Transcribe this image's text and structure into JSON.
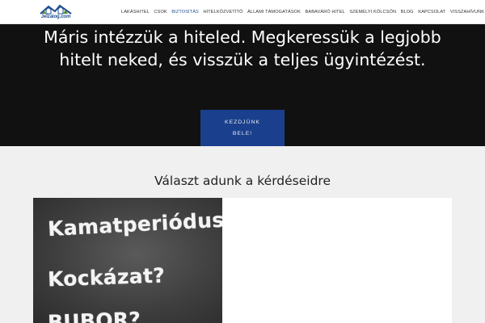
{
  "header": {
    "logo_text": "Jelzalog.com",
    "nav": [
      {
        "label": "LAKÁSHITEL"
      },
      {
        "label": "CSOK"
      },
      {
        "label": "BIZTOSÍTÁS",
        "active": true
      },
      {
        "label": "HITELKÖZVETÍTŐ"
      },
      {
        "label": "ÁLLAMI TÁMOGATÁSOK"
      },
      {
        "label": "BABAVÁRÓ HITEL"
      },
      {
        "label": "SZEMÉLYI KÖLCSÖN"
      },
      {
        "label": "BLOG"
      },
      {
        "label": "KAPCSOLAT"
      },
      {
        "label": "VISSZAHÍVUNK"
      }
    ]
  },
  "hero": {
    "text": "Máris intézzük a hiteled. Megkeressük a legjobb hitelt neked, és visszük a teljes ügyintézést.",
    "button_label": "KEZDJÜNK BELE!"
  },
  "section": {
    "title": "Választ adunk a kérdéseidre",
    "image_words": [
      "Kamatperiódus?",
      "Kockázat?",
      "BUBOR?"
    ]
  },
  "colors": {
    "accent": "#1a3f8c",
    "hero_bg": "#111111",
    "page_bg": "#f0f0f0"
  }
}
